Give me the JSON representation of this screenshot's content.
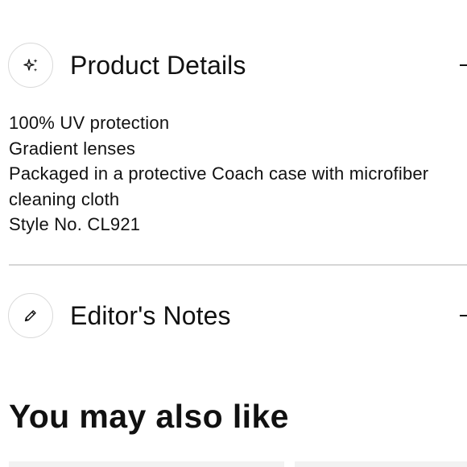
{
  "product_details": {
    "icon": "sparkles-icon",
    "title": "Product Details",
    "toggle": "–",
    "lines": [
      "100% UV protection",
      "Gradient lenses",
      "Packaged in a protective Coach case with microfiber",
      "cleaning cloth",
      "Style No. CL921"
    ]
  },
  "editors_notes": {
    "icon": "pencil-icon",
    "title": "Editor's Notes",
    "toggle": "–"
  },
  "recommendations": {
    "heading": "You may also like"
  },
  "colors": {
    "text": "#111111",
    "divider": "#d6d6d6",
    "icon_border": "#d9d9d9",
    "card_bg": "#f2f2f2"
  }
}
